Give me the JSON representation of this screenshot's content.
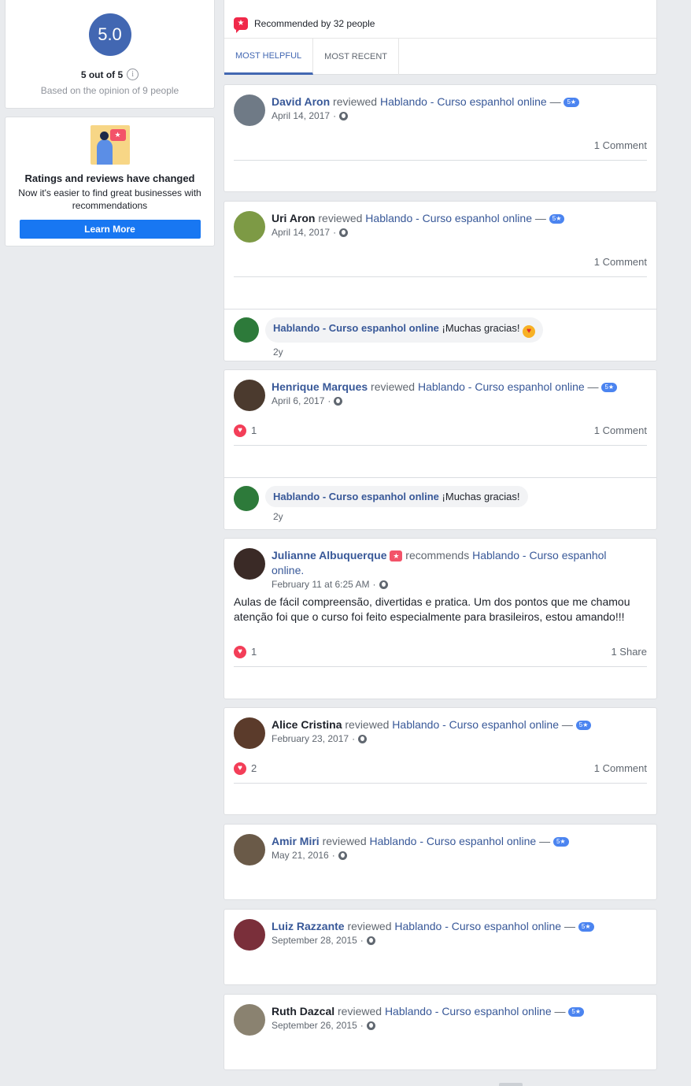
{
  "rating": {
    "score": "5.0",
    "out_of": "5 out of 5",
    "info": "i",
    "based_on": "Based on the opinion of 9 people"
  },
  "changed": {
    "title": "Ratings and reviews have changed",
    "text": "Now it's easier to find great businesses with recommendations",
    "button": "Learn More"
  },
  "header": {
    "recommended": "Recommended by 32 people",
    "tabs": [
      "MOST HELPFUL",
      "MOST RECENT"
    ]
  },
  "page_name": "Hablando - Curso espanhol online",
  "page_name_split": [
    "Hablando - Curso espanhol",
    "online."
  ],
  "reviewed_word": "reviewed",
  "recommends_word": "recommends",
  "dash": "—",
  "star_badge": "5★",
  "reviews": [
    {
      "name": "David Aron",
      "date": "April 14, 2017",
      "stat_right": "1 Comment"
    },
    {
      "name": "Uri Aron",
      "date": "April 14, 2017",
      "stat_right": "1 Comment",
      "reply": {
        "text": "¡Muchas gracias!",
        "time": "2y"
      }
    },
    {
      "name": "Henrique Marques",
      "date": "April 6, 2017",
      "likes": "1",
      "stat_right": "1 Comment",
      "reply": {
        "text": "¡Muchas gracias!",
        "time": "2y"
      }
    },
    {
      "name": "Julianne Albuquerque",
      "date": "February 11 at 6:25 AM",
      "text": "Aulas de fácil compreensão, divertidas e pratica. Um dos pontos que me chamou atenção foi que o curso foi feito especialmente para brasileiros, estou amando!!!",
      "likes": "1",
      "stat_right": "1 Share"
    },
    {
      "name": "Alice Cristina",
      "date": "February 23, 2017",
      "likes": "2",
      "stat_right": "1 Comment"
    },
    {
      "name": "Amir Miri",
      "date": "May 21, 2016"
    },
    {
      "name": "Luiz Razzante",
      "date": "September 28, 2015"
    },
    {
      "name": "Ruth Dazcal",
      "date": "September 26, 2015"
    }
  ],
  "colors": {
    "accent": "#4267b2",
    "link": "#385898",
    "button": "#1877f2",
    "badge": "#4b84f0",
    "love": "#f33e58"
  }
}
